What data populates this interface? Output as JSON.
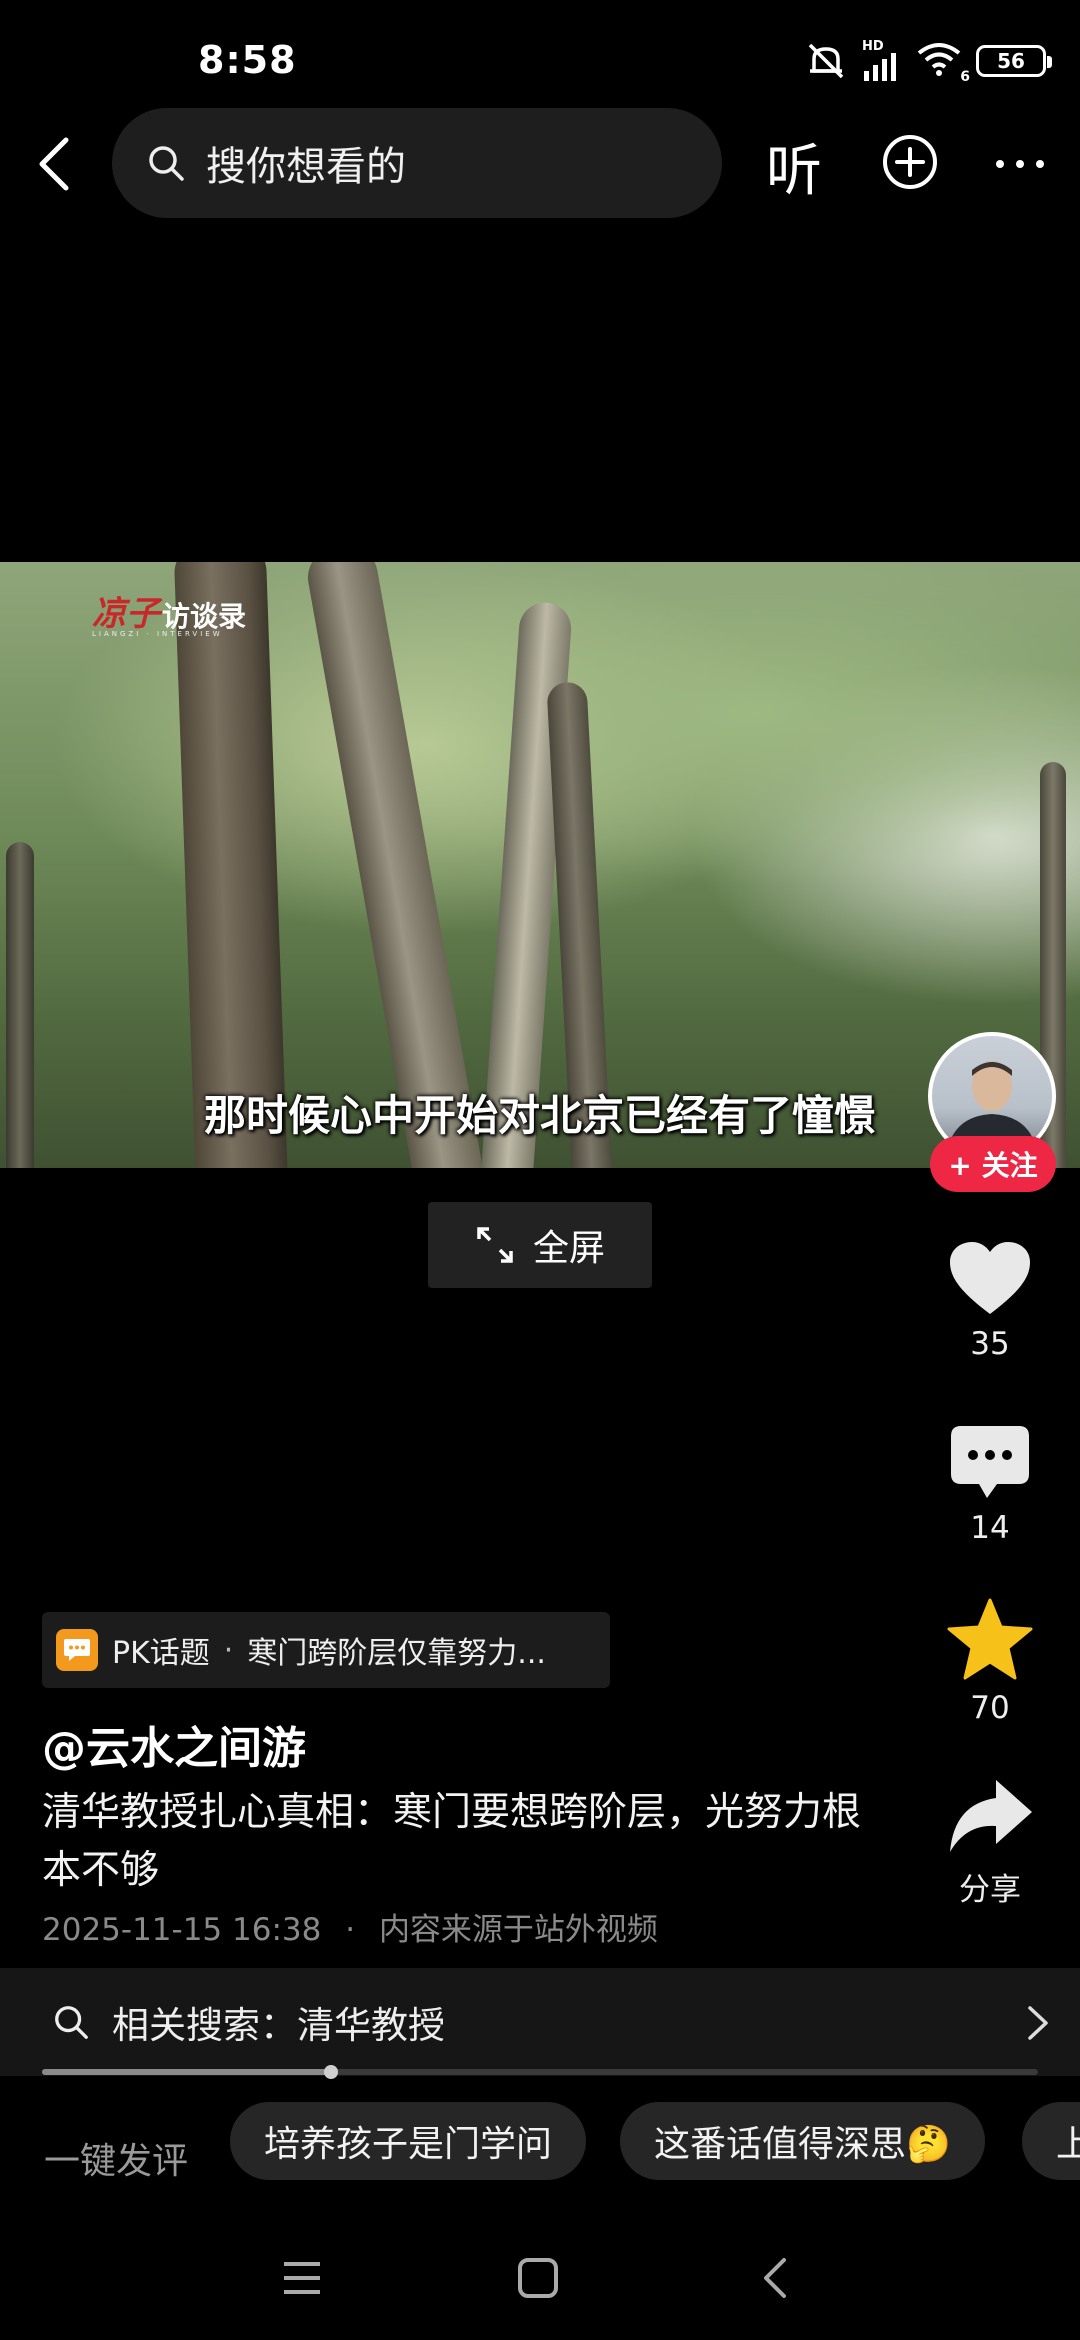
{
  "status_bar": {
    "time": "8:58",
    "network": "HD",
    "wifi_badge": "6",
    "battery": "56"
  },
  "top_bar": {
    "search_placeholder": "搜你想看的",
    "listen_label": "听"
  },
  "video": {
    "logo_text_a": "凉子",
    "logo_text_b": "访谈录",
    "logo_sub": "LIANGZI · INTERVIEW",
    "subtitle": "那时候心中开始对北京已经有了憧憬"
  },
  "follow_label": "+ 关注",
  "fullscreen_label": "全屏",
  "actions": {
    "likes": "35",
    "comments": "14",
    "favorites": "70",
    "share": "分享"
  },
  "pk": {
    "label": "PK话题",
    "separator": "·",
    "topic": "寒门跨阶层仅靠努力..."
  },
  "author": "@云水之间游",
  "description": "清华教授扎心真相：寒门要想跨阶层，光努力根本不够",
  "meta": {
    "datetime": "2025-11-15 16:38",
    "separator": "·",
    "source": "内容来源于站外视频"
  },
  "related": {
    "text": "相关搜索：清华教授"
  },
  "progress": 0.29,
  "quick_comment": {
    "label": "一键发评",
    "chips": [
      "培养孩子是门学问",
      "这番话值得深思🤔",
      "上"
    ]
  },
  "colors": {
    "accent_red": "#ee2745",
    "star_yellow": "#f6c21a",
    "pk_orange": "#f39a1e"
  }
}
